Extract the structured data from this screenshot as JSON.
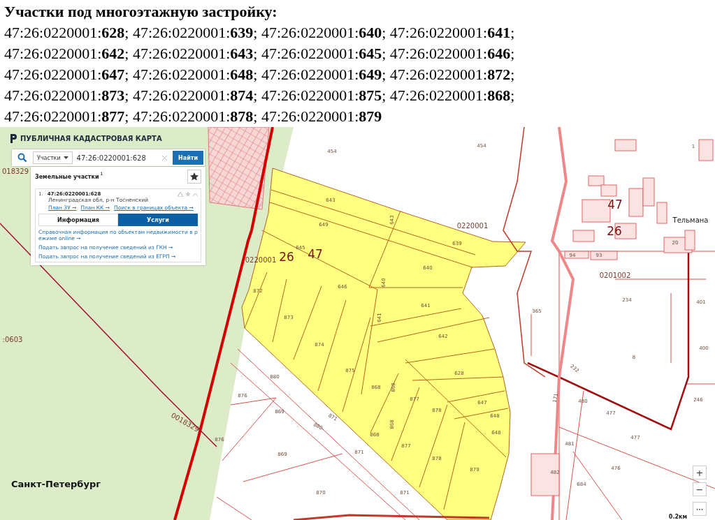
{
  "heading": "Участки под многоэтажную застройку:",
  "parcel_lines": [
    "47:26:0220001:**628**;  47:26:0220001:**639**; 47:26:0220001:**640**; 47:26:0220001:**641**;",
    "47:26:0220001:**642**;  47:26:0220001:**643**; 47:26:0220001:**645**; 47:26:0220001:**646**;",
    "47:26:0220001:**647**;  47:26:0220001:**648**; 47:26:0220001:**649**; 47:26:0220001:**872**;",
    "47:26:0220001:**873**; 47:26:0220001:**874**; 47:26:0220001:**875**; 47:26:0220001:**868**;",
    "47:26:0220001:**877**; 47:26:0220001:**878**; 47:26:0220001:**879**"
  ],
  "map": {
    "app_title": "ПУБЛИЧНАЯ КАДАСТРОВАЯ КАРТА",
    "search": {
      "category": "Участки",
      "value": "47:26:0220001:628",
      "button": "Найти"
    },
    "results": {
      "title": "Земельные участки",
      "count": "1",
      "items": [
        {
          "number": "1.",
          "cadastral_number": "47:26:0220001:628",
          "address": "Ленинградская обл, р-н Тосненский",
          "links": [
            "План ЗУ →",
            "План КК →",
            "Поиск в границах объекта →"
          ],
          "tabs": [
            {
              "label": "Информация",
              "selected": false
            },
            {
              "label": "Услуги",
              "selected": true
            }
          ],
          "service_links": [
            "Справочная информация по объектам недвижимости в режиме online →",
            "Подать запрос на получение сведений из ГКН →",
            "Подать запрос на получение сведений из ЕГРП →"
          ]
        }
      ]
    },
    "labels": [
      {
        "kind": "parcel",
        "text": "454"
      },
      {
        "kind": "parcel",
        "text": "454"
      },
      {
        "kind": "parcel",
        "text": "643"
      },
      {
        "kind": "parcel",
        "text": "649"
      },
      {
        "kind": "parcel",
        "text": "645"
      },
      {
        "kind": "parcel",
        "text": "646"
      },
      {
        "kind": "parcel",
        "text": "643"
      },
      {
        "kind": "parcel",
        "text": "639"
      },
      {
        "kind": "parcel",
        "text": "640"
      },
      {
        "kind": "parcel",
        "text": "640"
      },
      {
        "kind": "parcel",
        "text": "641"
      },
      {
        "kind": "parcel",
        "text": "641"
      },
      {
        "kind": "parcel",
        "text": "872"
      },
      {
        "kind": "parcel",
        "text": "873"
      },
      {
        "kind": "parcel",
        "text": "874"
      },
      {
        "kind": "parcel",
        "text": "875"
      },
      {
        "kind": "parcel",
        "text": "868"
      },
      {
        "kind": "parcel",
        "text": "868"
      },
      {
        "kind": "parcel",
        "text": "868"
      },
      {
        "kind": "parcel",
        "text": "868"
      },
      {
        "kind": "parcel",
        "text": "877"
      },
      {
        "kind": "parcel",
        "text": "877"
      },
      {
        "kind": "parcel",
        "text": "878"
      },
      {
        "kind": "parcel",
        "text": "878"
      },
      {
        "kind": "parcel",
        "text": "879"
      },
      {
        "kind": "parcel",
        "text": "628"
      },
      {
        "kind": "parcel",
        "text": "647"
      },
      {
        "kind": "parcel",
        "text": "648"
      },
      {
        "kind": "parcel",
        "text": "648"
      },
      {
        "kind": "parcel",
        "text": "642"
      },
      {
        "kind": "parcel",
        "text": "880"
      },
      {
        "kind": "parcel",
        "text": "876"
      },
      {
        "kind": "parcel",
        "text": "869"
      },
      {
        "kind": "parcel",
        "text": "880"
      },
      {
        "kind": "parcel",
        "text": "871"
      },
      {
        "kind": "parcel",
        "text": "876"
      },
      {
        "kind": "parcel",
        "text": "869"
      },
      {
        "kind": "parcel",
        "text": "871"
      },
      {
        "kind": "parcel",
        "text": "870"
      },
      {
        "kind": "parcel",
        "text": "871"
      },
      {
        "kind": "parcel",
        "text": "234"
      },
      {
        "kind": "parcel",
        "text": "401"
      },
      {
        "kind": "parcel",
        "text": "365"
      },
      {
        "kind": "parcel",
        "text": "8"
      },
      {
        "kind": "parcel",
        "text": "400"
      },
      {
        "kind": "parcel",
        "text": "480"
      },
      {
        "kind": "parcel",
        "text": "246"
      },
      {
        "kind": "parcel",
        "text": "477"
      },
      {
        "kind": "parcel",
        "text": "477"
      },
      {
        "kind": "parcel",
        "text": "481"
      },
      {
        "kind": "parcel",
        "text": "476"
      },
      {
        "kind": "parcel",
        "text": "482"
      },
      {
        "kind": "parcel",
        "text": "684"
      },
      {
        "kind": "parcel",
        "text": "171"
      },
      {
        "kind": "parcel",
        "text": "232"
      },
      {
        "kind": "parcel",
        "text": "94"
      },
      {
        "kind": "parcel",
        "text": "93"
      },
      {
        "kind": "parcel",
        "text": "20"
      },
      {
        "kind": "parcel",
        "text": "1"
      },
      {
        "kind": "quarter",
        "text": "0220001"
      },
      {
        "kind": "quarter",
        "text": "0220001"
      },
      {
        "kind": "quarter",
        "text": "0201002"
      },
      {
        "kind": "quarter",
        "text": "0018329"
      },
      {
        "kind": "quarter",
        "text": "018329"
      },
      {
        "kind": "quarter",
        "text": ":0603"
      },
      {
        "kind": "region",
        "text": "26"
      },
      {
        "kind": "region",
        "text": "47"
      },
      {
        "kind": "region",
        "text": "47"
      },
      {
        "kind": "region",
        "text": "26"
      },
      {
        "kind": "place",
        "text": "Тельмана"
      },
      {
        "kind": "city",
        "text": "Санкт-Петербург"
      }
    ],
    "zoom_controls": [
      {
        "kind": "zoom-in",
        "label": "+"
      },
      {
        "kind": "zoom-out",
        "label": "−"
      },
      {
        "kind": "more",
        "label": "•••"
      }
    ],
    "scale": "0.2км"
  }
}
